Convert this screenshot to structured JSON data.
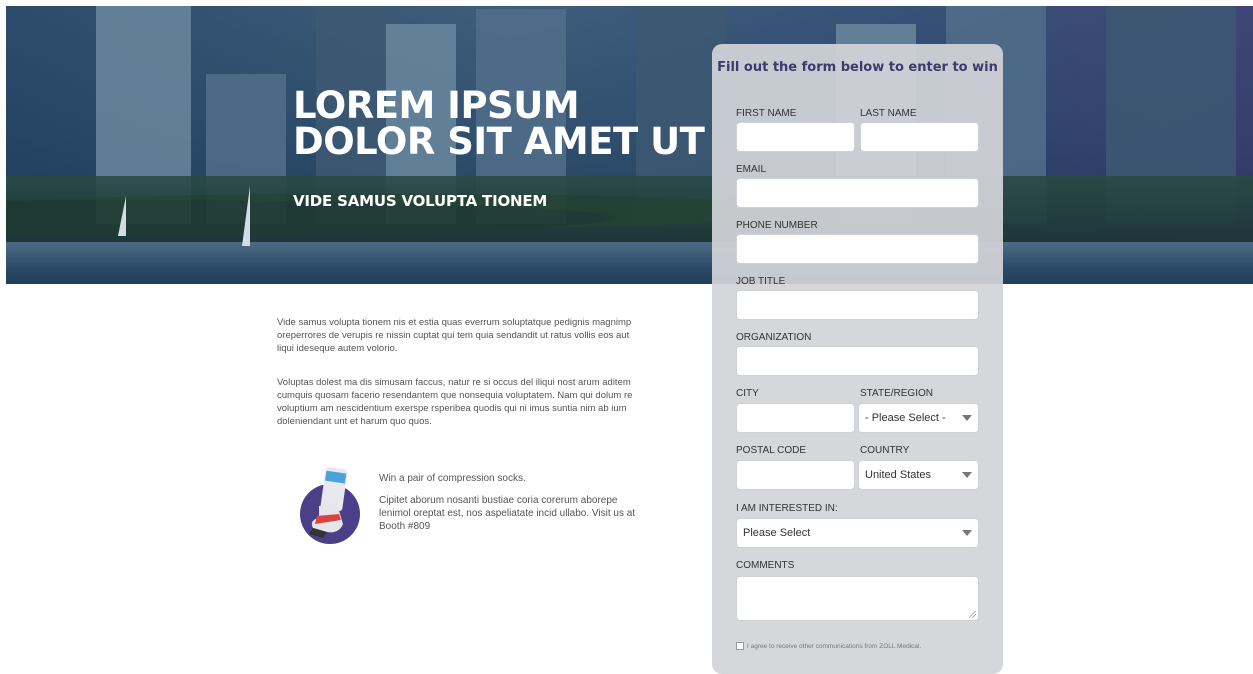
{
  "hero": {
    "title_line1": "LOREM IPSUM",
    "title_line2": "DOLOR SIT AMET UT",
    "subtitle": "VIDE SAMUS VOLUPTA TIONEM"
  },
  "content": {
    "paragraph1": "Vide samus volupta tionem nis et estia quas everrum soluptatque pedignis magnimp oreperrores de verupis re nissin cuptat qui tem quia sendandit ut ratus vollis eos aut liqui ideseque autem volorio.",
    "paragraph2": "Voluptas dolest ma dis simusam faccus, natur re si occus del iliqui nost arum aditem cumquis quosam facerio resendantem que nonsequia voluptatem. Nam qui dolum re voluptium am nescidentium exerspe rsperibea quodis qui ni imus suntia nim ab ium doleniendant unt et harum quo quos.",
    "promo_title": "Win a pair of compression socks.",
    "promo_text": "Cipitet aborum nosanti bustiae coria corerum aborepe lenimol oreptat est, nos aspeliatate incid ullabo. Visit us at Booth #809"
  },
  "form": {
    "title": "Fill out the form below to enter to win",
    "labels": {
      "first_name": "FIRST NAME",
      "last_name": "LAST NAME",
      "email": "EMAIL",
      "phone": "PHONE NUMBER",
      "job_title": "JOB TITLE",
      "organization": "ORGANIZATION",
      "city": "CITY",
      "state": "STATE/REGION",
      "postal": "POSTAL CODE",
      "country": "COUNTRY",
      "interest": "I AM INTERESTED IN:",
      "comments": "COMMENTS"
    },
    "state_value": "- Please Select -",
    "country_value": "United States",
    "interest_value": "Please Select",
    "agree_text": "I agree to receive other communications from ZOLL Medical."
  },
  "colors": {
    "form_title": "#3c3a6e",
    "panel": "#d2d4d8",
    "hero": "#2f4f6c"
  }
}
